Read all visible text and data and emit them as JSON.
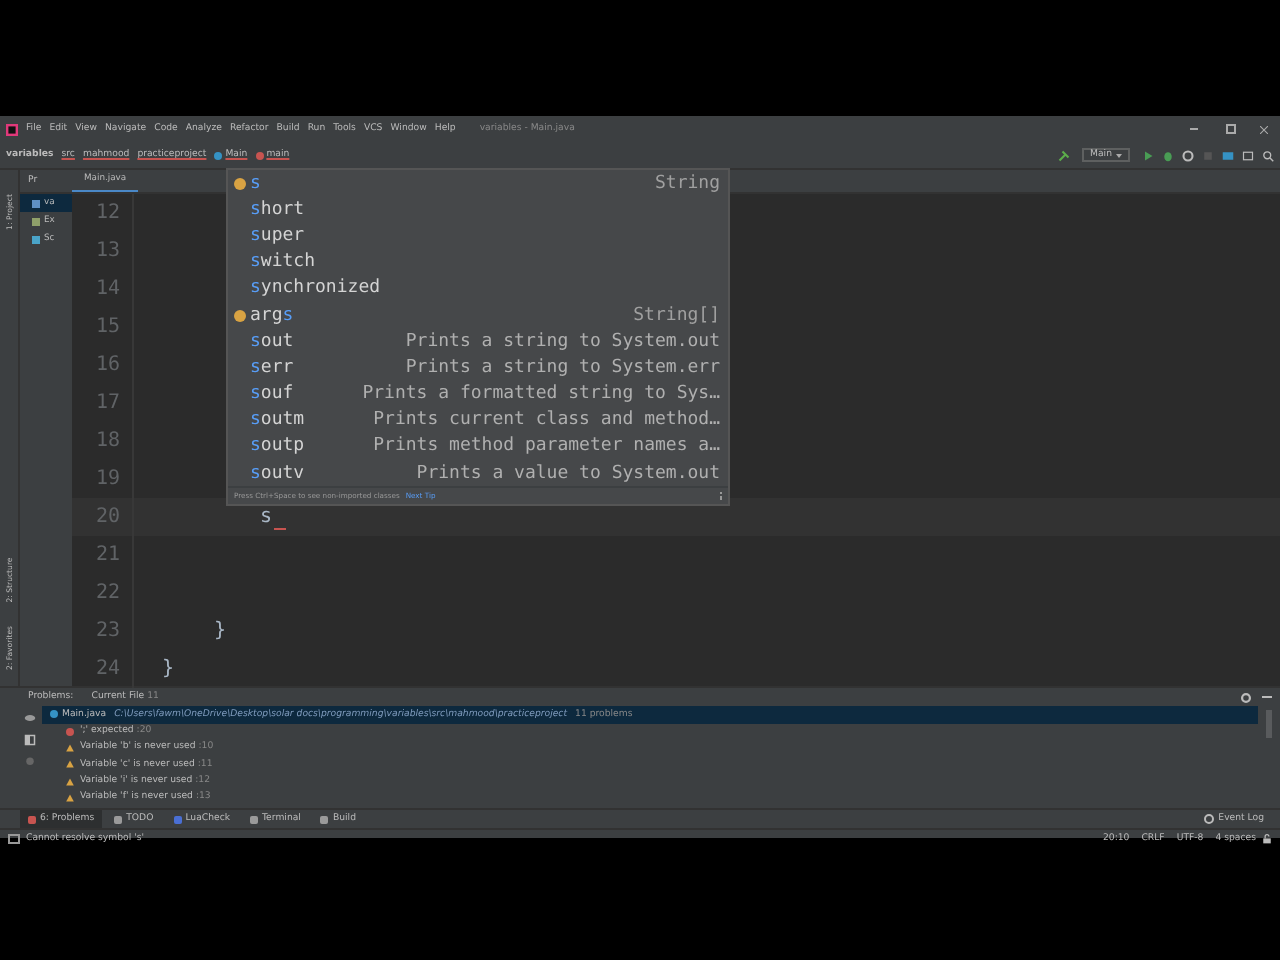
{
  "window": {
    "title": "variables - Main.java"
  },
  "menu": [
    "File",
    "Edit",
    "View",
    "Navigate",
    "Code",
    "Analyze",
    "Refactor",
    "Build",
    "Run",
    "Tools",
    "VCS",
    "Window",
    "Help"
  ],
  "breadcrumbs": [
    {
      "label": "variables",
      "kind": "project"
    },
    {
      "label": "src",
      "kind": "folder"
    },
    {
      "label": "mahmood",
      "kind": "folder"
    },
    {
      "label": "practiceproject",
      "kind": "folder"
    },
    {
      "label": "Main",
      "kind": "class"
    },
    {
      "label": "main",
      "kind": "method"
    }
  ],
  "run_config": "Main",
  "left_tabs_top": [
    "1: Project"
  ],
  "left_tabs_bottom": [
    "2: Structure",
    "2: Favorites"
  ],
  "project_panel": {
    "tab": "Pr",
    "items": [
      {
        "label": "va",
        "kind": "module",
        "selected": true
      },
      {
        "label": "Ex",
        "kind": "library",
        "selected": false
      },
      {
        "label": "Sc",
        "kind": "scratch",
        "selected": false
      }
    ]
  },
  "editor": {
    "tab": "Main.java",
    "lines": [
      {
        "number": "12"
      },
      {
        "number": "13"
      },
      {
        "number": "14"
      },
      {
        "number": "15"
      },
      {
        "number": "16"
      },
      {
        "number": "17"
      },
      {
        "number": "18"
      },
      {
        "number": "19"
      },
      {
        "number": "20",
        "text": "s",
        "current": true,
        "error": true
      },
      {
        "number": "21"
      },
      {
        "number": "22"
      },
      {
        "number": "23",
        "text": "}"
      },
      {
        "number": "24",
        "text": "}"
      }
    ]
  },
  "completion": {
    "items": [
      {
        "kind": "variable",
        "match": "s",
        "detail": "String"
      },
      {
        "kind": "keyword",
        "match": "s",
        "after": "hort"
      },
      {
        "kind": "keyword",
        "match": "s",
        "after": "uper"
      },
      {
        "kind": "keyword",
        "match": "s",
        "after": "witch"
      },
      {
        "kind": "keyword",
        "match": "s",
        "after": "ynchronized"
      },
      {
        "kind": "parameter",
        "before": "arg",
        "match": "s",
        "detail": "String[]"
      },
      {
        "kind": "template",
        "match": "s",
        "after": "out",
        "detail": "Prints a string to System.out"
      },
      {
        "kind": "template",
        "match": "s",
        "after": "err",
        "detail": "Prints a string to System.err"
      },
      {
        "kind": "template",
        "match": "s",
        "after": "ouf",
        "detail": "Prints a formatted string to Sys…"
      },
      {
        "kind": "template",
        "match": "s",
        "after": "outm",
        "detail": "Prints current class and method…"
      },
      {
        "kind": "template",
        "match": "s",
        "after": "outp",
        "detail": "Prints method parameter names a…"
      },
      {
        "kind": "template",
        "match": "s",
        "after": "outv",
        "detail": "Prints a value to System.out"
      }
    ],
    "footer": "Press Ctrl+Space to see non-imported classes",
    "footer_link": "Next Tip"
  },
  "problems": {
    "tabs": [
      {
        "label": "Problems:",
        "selected": false
      },
      {
        "label": "Current File",
        "count": "11",
        "selected": true
      }
    ],
    "file": {
      "name": "Main.java",
      "path": "C:\\Users\\fawm\\OneDrive\\Desktop\\solar docs\\programming\\variables\\src\\mahmood\\practiceproject",
      "summary": "11 problems"
    },
    "items": [
      {
        "kind": "error",
        "text": "';' expected",
        "line": ":20"
      },
      {
        "kind": "warning",
        "text": "Variable 'b' is never used",
        "line": ":10"
      },
      {
        "kind": "warning",
        "text": "Variable 'c' is never used",
        "line": ":11"
      },
      {
        "kind": "warning",
        "text": "Variable 'i' is never used",
        "line": ":12"
      },
      {
        "kind": "warning",
        "text": "Variable 'f' is never used",
        "line": ":13"
      }
    ]
  },
  "tool_windows": [
    {
      "label": "6: Problems",
      "kind": "error",
      "selected": true
    },
    {
      "label": "TODO",
      "kind": "list",
      "selected": false
    },
    {
      "label": "LuaCheck",
      "kind": "lua",
      "selected": false
    },
    {
      "label": "Terminal",
      "kind": "terminal",
      "selected": false
    },
    {
      "label": "Build",
      "kind": "hammer",
      "selected": false
    }
  ],
  "event_log": "Event Log",
  "status": {
    "message": "Cannot resolve symbol 's'",
    "position": "20:10",
    "line_separator": "CRLF",
    "encoding": "UTF-8",
    "indent": "4 spaces"
  }
}
